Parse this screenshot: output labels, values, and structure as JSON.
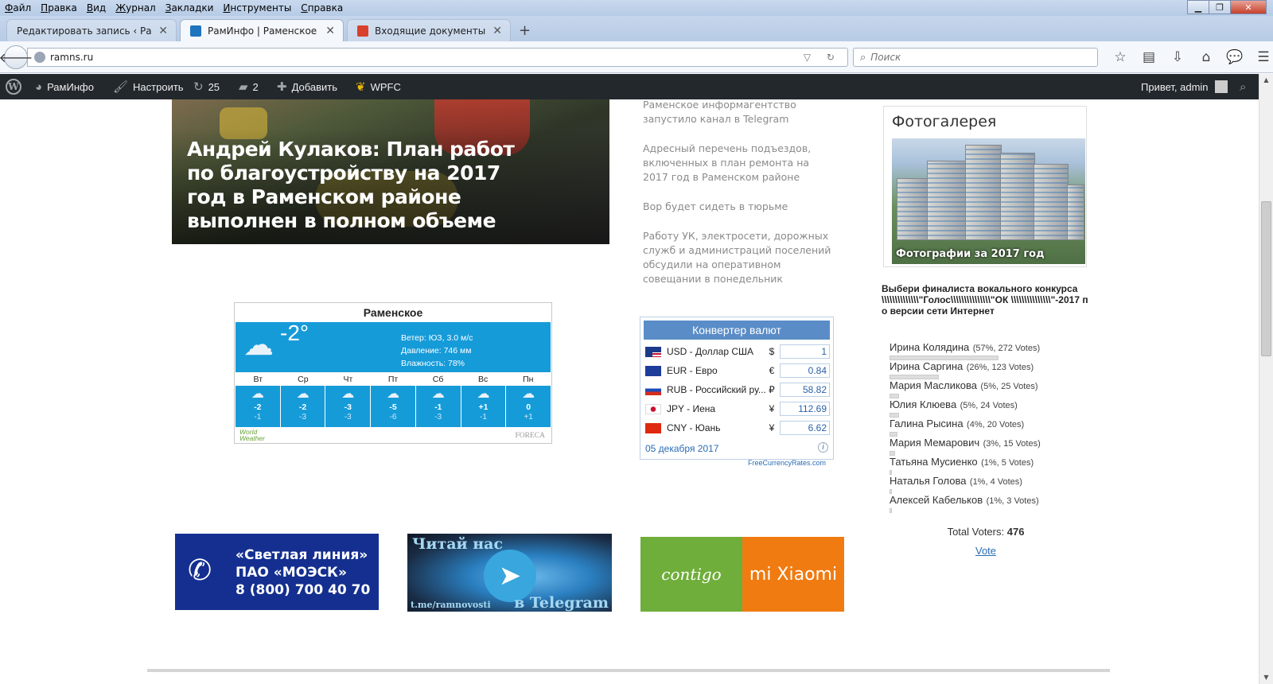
{
  "menu": [
    "Файл",
    "Правка",
    "Вид",
    "Журнал",
    "Закладки",
    "Инструменты",
    "Справка"
  ],
  "tabs": [
    {
      "title": "Редактировать запись ‹ РамИ...",
      "active": false
    },
    {
      "title": "РамИнфо | Раменское ин...",
      "active": true
    },
    {
      "title": "Входящие документы : Бе...",
      "active": false
    }
  ],
  "address": {
    "url": "ramns.ru",
    "search_placeholder": "Поиск"
  },
  "adminbar": {
    "site": "РамИнфо",
    "customize": "Настроить",
    "updates": "25",
    "comments": "2",
    "add": "Добавить",
    "plugin": "WPFC",
    "greeting": "Привет, admin"
  },
  "hero": {
    "title": "Андрей Кулаков: План работ по благоустройству на 2017 год в Раменском районе выполнен в полном объеме"
  },
  "news": [
    "Раменское информагентство запустило канал в Telegram",
    "Адресный перечень подъездов, включенных в план ремонта на 2017 год в Раменском районе",
    "Вор будет сидеть в тюрьме",
    "Работу УК, электросети, дорожных служб и администраций поселений обсудили на оперативном совещании в понедельник"
  ],
  "weather": {
    "city": "Раменское",
    "temp": "-2°",
    "wind": "Ветер: ЮЗ, 3.0 м/с",
    "pressure": "Давление: 746 мм",
    "humidity": "Влажность: 78%",
    "days": [
      {
        "name": "Вт",
        "hi": "-2",
        "lo": "-1"
      },
      {
        "name": "Ср",
        "hi": "-2",
        "lo": "-3"
      },
      {
        "name": "Чт",
        "hi": "-3",
        "lo": "-3"
      },
      {
        "name": "Пт",
        "hi": "-5",
        "lo": "-6"
      },
      {
        "name": "Сб",
        "hi": "-1",
        "lo": "-3"
      },
      {
        "name": "Вс",
        "hi": "+1",
        "lo": "-1"
      },
      {
        "name": "Пн",
        "hi": "0",
        "lo": "+1"
      }
    ],
    "brand_left_1": "World",
    "brand_left_2": "Weather",
    "brand_right": "FORECA"
  },
  "converter": {
    "title": "Конвертер валют",
    "rows": [
      {
        "name": "USD - Доллар США",
        "sym": "$",
        "value": "1"
      },
      {
        "name": "EUR - Евро",
        "sym": "€",
        "value": "0.84"
      },
      {
        "name": "RUB - Российский ру...",
        "sym": "₽",
        "value": "58.82"
      },
      {
        "name": "JPY - Иена",
        "sym": "¥",
        "value": "112.69"
      },
      {
        "name": "CNY - Юань",
        "sym": "¥",
        "value": "6.62"
      }
    ],
    "date": "05 декабря 2017",
    "info": "i",
    "footer": "FreeCurrencyRates.com"
  },
  "gallery": {
    "title": "Фотогалерея",
    "caption": "Фотографии за 2017 год"
  },
  "poll": {
    "question": "Выбери финалиста вокального конкурса \\\\\\\\\\\\\\\\\\\\\\\\\\\\\"Голос\\\\\\\\\\\\\\\\\\\\\\\\\\\\\\\"ОК \\\\\\\\\\\\\\\\\\\\\\\\\\\\\\\"-2017 по версии сети Интернет",
    "answers": [
      {
        "name": "Ирина Колядина",
        "meta": "(57%, 272 Votes)",
        "percent": 57
      },
      {
        "name": "Ирина Саргина",
        "meta": "(26%, 123 Votes)",
        "percent": 26
      },
      {
        "name": "Мария Масликова",
        "meta": "(5%, 25 Votes)",
        "percent": 5
      },
      {
        "name": "Юлия Клюева",
        "meta": "(5%, 24 Votes)",
        "percent": 5
      },
      {
        "name": "Галина Рысина",
        "meta": "(4%, 20 Votes)",
        "percent": 4
      },
      {
        "name": "Мария Мемарович",
        "meta": "(3%, 15 Votes)",
        "percent": 3
      },
      {
        "name": "Татьяна Мусиенко",
        "meta": "(1%, 5 Votes)",
        "percent": 1
      },
      {
        "name": "Наталья Голова",
        "meta": "(1%, 4 Votes)",
        "percent": 1
      },
      {
        "name": "Алексей Кабельков",
        "meta": "(1%, 3 Votes)",
        "percent": 1
      }
    ],
    "total_label": "Total Voters:",
    "total_value": "476",
    "vote": "Vote"
  },
  "banners": {
    "moesk": {
      "line1": "«Светлая линия»",
      "line2": "ПАО «МОЭСК»",
      "line3": "8 (800) 700 40 70"
    },
    "telegram": {
      "line1": "Читай нас",
      "line2": "t.me/ramnovosti",
      "line3": "в Telegram"
    },
    "contigo": {
      "left": "contigo",
      "right": "mi Xiaomi"
    }
  }
}
